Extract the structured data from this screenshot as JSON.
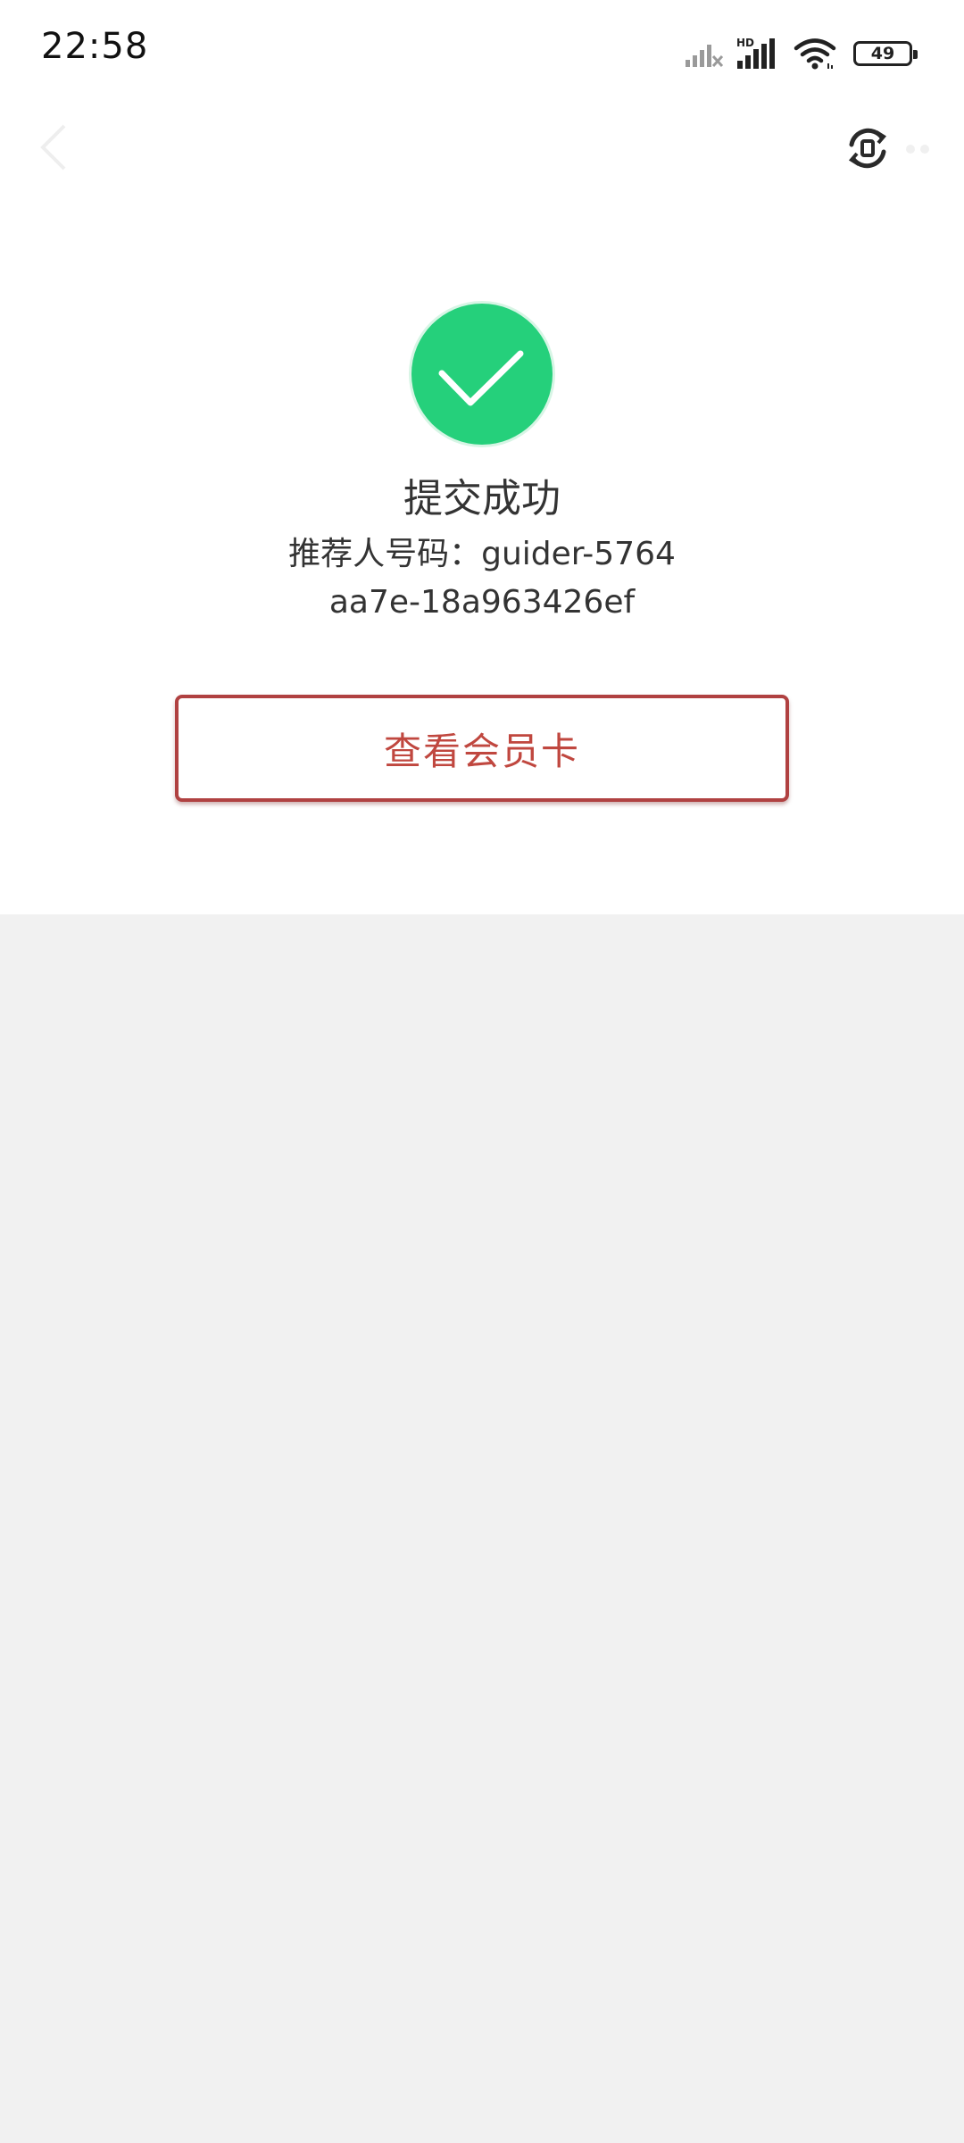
{
  "status_bar": {
    "time": "22:58",
    "network_badge": "HD",
    "battery_level": "49",
    "icons": [
      "signal-weak-icon",
      "signal-strong-icon",
      "wifi-icon",
      "battery-icon"
    ]
  },
  "nav_bar": {
    "icons": [
      "back-arrow-icon",
      "refresh-icon",
      "more-icon"
    ]
  },
  "result": {
    "icon": "check-circle-icon",
    "title": "提交成功",
    "referrer_text": "推荐人号码：guider-5764aa7e-18a963426ef"
  },
  "actions": {
    "view_card_label": "查看会员卡"
  },
  "colors": {
    "success_green": "#25d07b",
    "button_red": "#c0473f",
    "button_border": "#b04141",
    "page_background": "#f1f1f1",
    "card_background": "#ffffff"
  }
}
